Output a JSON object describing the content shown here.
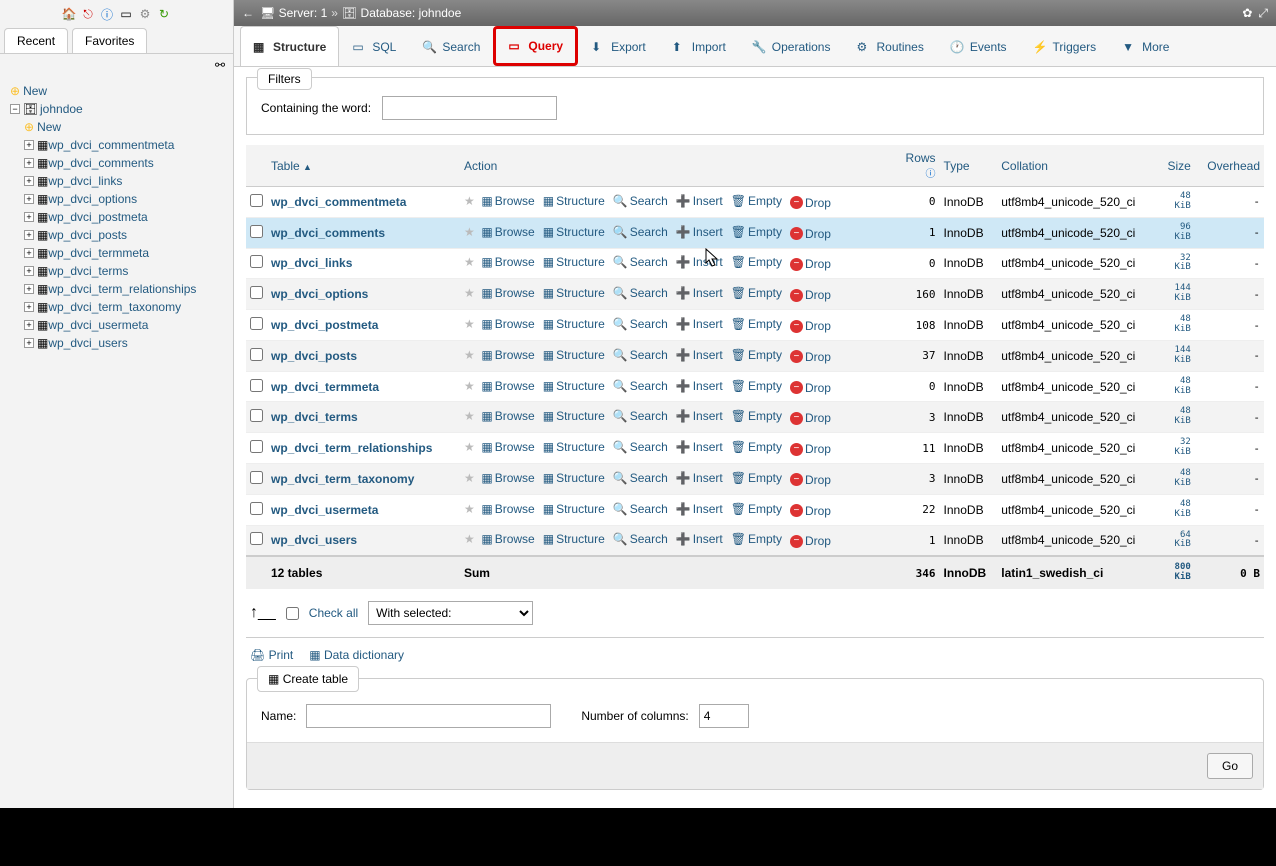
{
  "breadcrumb": {
    "server_label": "Server: 1",
    "db_label": "Database: johndoe"
  },
  "sidebar": {
    "tabs": {
      "recent": "Recent",
      "favorites": "Favorites"
    },
    "new": "New",
    "db": "johndoe",
    "tables": [
      "wp_dvci_commentmeta",
      "wp_dvci_comments",
      "wp_dvci_links",
      "wp_dvci_options",
      "wp_dvci_postmeta",
      "wp_dvci_posts",
      "wp_dvci_termmeta",
      "wp_dvci_terms",
      "wp_dvci_term_relationships",
      "wp_dvci_term_taxonomy",
      "wp_dvci_usermeta",
      "wp_dvci_users"
    ]
  },
  "tabs": [
    {
      "label": "Structure"
    },
    {
      "label": "SQL"
    },
    {
      "label": "Search"
    },
    {
      "label": "Query"
    },
    {
      "label": "Export"
    },
    {
      "label": "Import"
    },
    {
      "label": "Operations"
    },
    {
      "label": "Routines"
    },
    {
      "label": "Events"
    },
    {
      "label": "Triggers"
    },
    {
      "label": "More"
    }
  ],
  "filters": {
    "legend": "Filters",
    "label": "Containing the word:"
  },
  "headers": {
    "table": "Table",
    "action": "Action",
    "rows": "Rows",
    "type": "Type",
    "collation": "Collation",
    "size": "Size",
    "overhead": "Overhead"
  },
  "actions": {
    "browse": "Browse",
    "structure": "Structure",
    "search": "Search",
    "insert": "Insert",
    "empty": "Empty",
    "drop": "Drop"
  },
  "rows": [
    {
      "name": "wp_dvci_commentmeta",
      "rows": 0,
      "type": "InnoDB",
      "collation": "utf8mb4_unicode_520_ci",
      "size": "48 KiB",
      "overhead": "-"
    },
    {
      "name": "wp_dvci_comments",
      "rows": 1,
      "type": "InnoDB",
      "collation": "utf8mb4_unicode_520_ci",
      "size": "96 KiB",
      "overhead": "-",
      "hover": true
    },
    {
      "name": "wp_dvci_links",
      "rows": 0,
      "type": "InnoDB",
      "collation": "utf8mb4_unicode_520_ci",
      "size": "32 KiB",
      "overhead": "-"
    },
    {
      "name": "wp_dvci_options",
      "rows": 160,
      "type": "InnoDB",
      "collation": "utf8mb4_unicode_520_ci",
      "size": "144 KiB",
      "overhead": "-"
    },
    {
      "name": "wp_dvci_postmeta",
      "rows": 108,
      "type": "InnoDB",
      "collation": "utf8mb4_unicode_520_ci",
      "size": "48 KiB",
      "overhead": "-"
    },
    {
      "name": "wp_dvci_posts",
      "rows": 37,
      "type": "InnoDB",
      "collation": "utf8mb4_unicode_520_ci",
      "size": "144 KiB",
      "overhead": "-"
    },
    {
      "name": "wp_dvci_termmeta",
      "rows": 0,
      "type": "InnoDB",
      "collation": "utf8mb4_unicode_520_ci",
      "size": "48 KiB",
      "overhead": "-"
    },
    {
      "name": "wp_dvci_terms",
      "rows": 3,
      "type": "InnoDB",
      "collation": "utf8mb4_unicode_520_ci",
      "size": "48 KiB",
      "overhead": "-"
    },
    {
      "name": "wp_dvci_term_relationships",
      "rows": 11,
      "type": "InnoDB",
      "collation": "utf8mb4_unicode_520_ci",
      "size": "32 KiB",
      "overhead": "-"
    },
    {
      "name": "wp_dvci_term_taxonomy",
      "rows": 3,
      "type": "InnoDB",
      "collation": "utf8mb4_unicode_520_ci",
      "size": "48 KiB",
      "overhead": "-"
    },
    {
      "name": "wp_dvci_usermeta",
      "rows": 22,
      "type": "InnoDB",
      "collation": "utf8mb4_unicode_520_ci",
      "size": "48 KiB",
      "overhead": "-"
    },
    {
      "name": "wp_dvci_users",
      "rows": 1,
      "type": "InnoDB",
      "collation": "utf8mb4_unicode_520_ci",
      "size": "64 KiB",
      "overhead": "-"
    }
  ],
  "sum": {
    "label": "12 tables",
    "sum": "Sum",
    "rows": 346,
    "type": "InnoDB",
    "collation": "latin1_swedish_ci",
    "size": "800 KiB",
    "overhead": "0 B"
  },
  "checkall": {
    "label": "Check all",
    "select": "With selected:"
  },
  "links": {
    "print": "Print",
    "dict": "Data dictionary"
  },
  "create": {
    "title": "Create table",
    "name": "Name:",
    "cols": "Number of columns:",
    "cols_value": "4",
    "go": "Go"
  }
}
